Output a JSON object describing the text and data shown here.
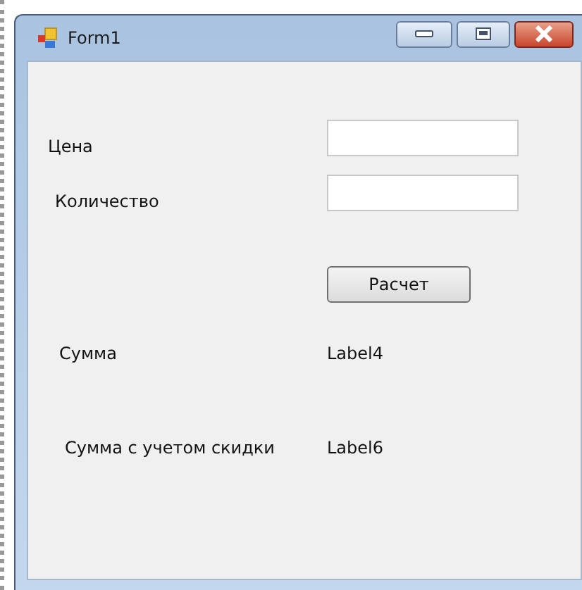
{
  "window": {
    "title": "Form1"
  },
  "rows": [
    {
      "kind": "field",
      "label": "Цена"
    },
    {
      "kind": "field",
      "label": "Количество"
    },
    {
      "kind": "button",
      "label": "Расчет"
    },
    {
      "kind": "output",
      "label": "Сумма",
      "value": "Label4"
    },
    {
      "kind": "output",
      "label": "Сумма с учетом скидки",
      "value": "Label6"
    }
  ]
}
